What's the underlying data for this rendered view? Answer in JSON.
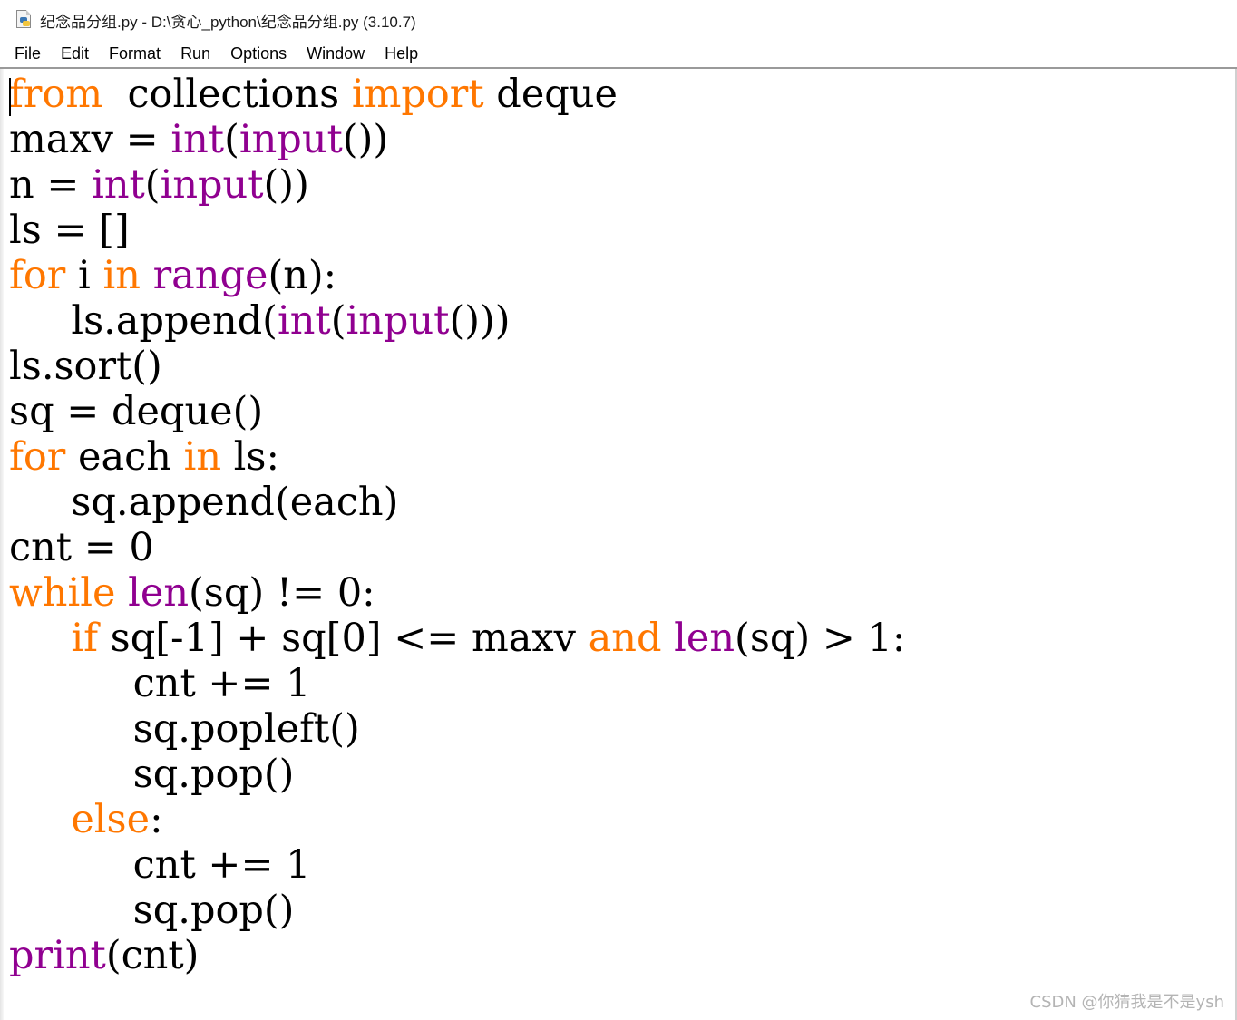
{
  "window": {
    "title": "纪念品分组.py - D:\\贪心_python\\纪念品分组.py (3.10.7)",
    "app_icon": "python-file-icon"
  },
  "menu": [
    "File",
    "Edit",
    "Format",
    "Run",
    "Options",
    "Window",
    "Help"
  ],
  "editor": {
    "syntax_colors": {
      "keyword": "#ff7700",
      "builtin": "#900090",
      "default": "#000000"
    },
    "lines": [
      [
        [
          "kw",
          "from"
        ],
        [
          "",
          "  collections "
        ],
        [
          "kw",
          "import"
        ],
        [
          "",
          " deque"
        ]
      ],
      [
        [
          "",
          "maxv = "
        ],
        [
          "bi",
          "int"
        ],
        [
          "",
          "("
        ],
        [
          "bi",
          "input"
        ],
        [
          "",
          "())"
        ]
      ],
      [
        [
          "",
          "n = "
        ],
        [
          "bi",
          "int"
        ],
        [
          "",
          "("
        ],
        [
          "bi",
          "input"
        ],
        [
          "",
          "())"
        ]
      ],
      [
        [
          "",
          "ls = []"
        ]
      ],
      [
        [
          "kw",
          "for"
        ],
        [
          "",
          " i "
        ],
        [
          "kw",
          "in"
        ],
        [
          "",
          " "
        ],
        [
          "bi",
          "range"
        ],
        [
          "",
          "(n):"
        ]
      ],
      [
        [
          "",
          "     ls.append("
        ],
        [
          "bi",
          "int"
        ],
        [
          "",
          "("
        ],
        [
          "bi",
          "input"
        ],
        [
          "",
          "()))"
        ]
      ],
      [
        [
          "",
          "ls.sort()"
        ]
      ],
      [
        [
          "",
          "sq = deque()"
        ]
      ],
      [
        [
          "kw",
          "for"
        ],
        [
          "",
          " each "
        ],
        [
          "kw",
          "in"
        ],
        [
          "",
          " ls:"
        ]
      ],
      [
        [
          "",
          "     sq.append(each)"
        ]
      ],
      [
        [
          "",
          "cnt = 0"
        ]
      ],
      [
        [
          "kw",
          "while"
        ],
        [
          "",
          " "
        ],
        [
          "bi",
          "len"
        ],
        [
          "",
          "(sq) != 0:"
        ]
      ],
      [
        [
          "",
          "     "
        ],
        [
          "kw",
          "if"
        ],
        [
          "",
          " sq[-1] + sq[0] <= maxv "
        ],
        [
          "kw",
          "and"
        ],
        [
          "",
          " "
        ],
        [
          "bi",
          "len"
        ],
        [
          "",
          "(sq) > 1:"
        ]
      ],
      [
        [
          "",
          "          cnt += 1"
        ]
      ],
      [
        [
          "",
          "          sq.popleft()"
        ]
      ],
      [
        [
          "",
          "          sq.pop()"
        ]
      ],
      [
        [
          "",
          "     "
        ],
        [
          "kw",
          "else"
        ],
        [
          "",
          ":"
        ]
      ],
      [
        [
          "",
          "          cnt += 1"
        ]
      ],
      [
        [
          "",
          "          sq.pop()"
        ]
      ],
      [
        [
          "bi",
          "print"
        ],
        [
          "",
          "(cnt)"
        ]
      ]
    ]
  },
  "watermark": "CSDN @你猜我是不是ysh"
}
